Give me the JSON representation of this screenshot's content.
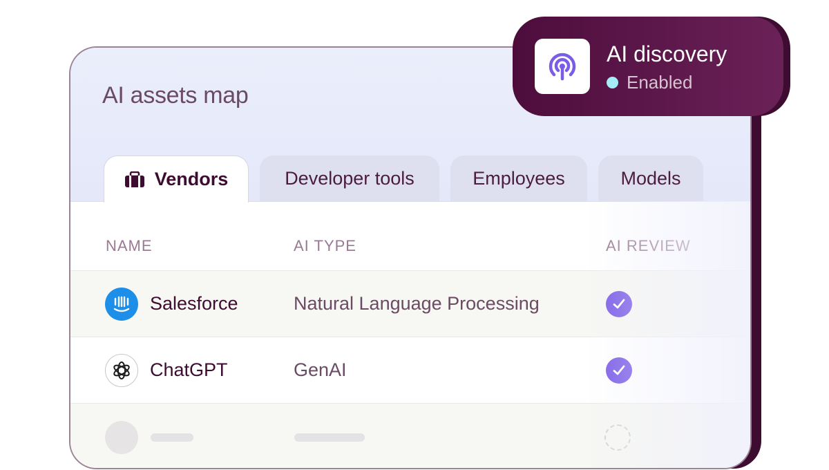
{
  "card": {
    "title": "AI assets map",
    "tabs": [
      {
        "label": "Vendors",
        "icon": "briefcase-icon",
        "active": true
      },
      {
        "label": "Developer tools",
        "active": false
      },
      {
        "label": "Employees",
        "active": false
      },
      {
        "label": "Models",
        "active": false
      }
    ],
    "columns": {
      "name": "NAME",
      "type": "AI TYPE",
      "review": "AI REVIEW"
    },
    "rows": [
      {
        "name": "Salesforce",
        "icon": "salesforce-logo-icon",
        "type": "Natural Language Processing",
        "reviewed": true
      },
      {
        "name": "ChatGPT",
        "icon": "chatgpt-logo-icon",
        "type": "GenAI",
        "reviewed": true
      }
    ]
  },
  "badge": {
    "title": "AI discovery",
    "status": "Enabled",
    "icon": "broadcast-signal-icon"
  },
  "colors": {
    "brand_dark": "#4d0d3c",
    "accent_purple": "#7b5ce6",
    "status_dot": "#a6ecf6",
    "salesforce_blue": "#1e8fe8"
  }
}
